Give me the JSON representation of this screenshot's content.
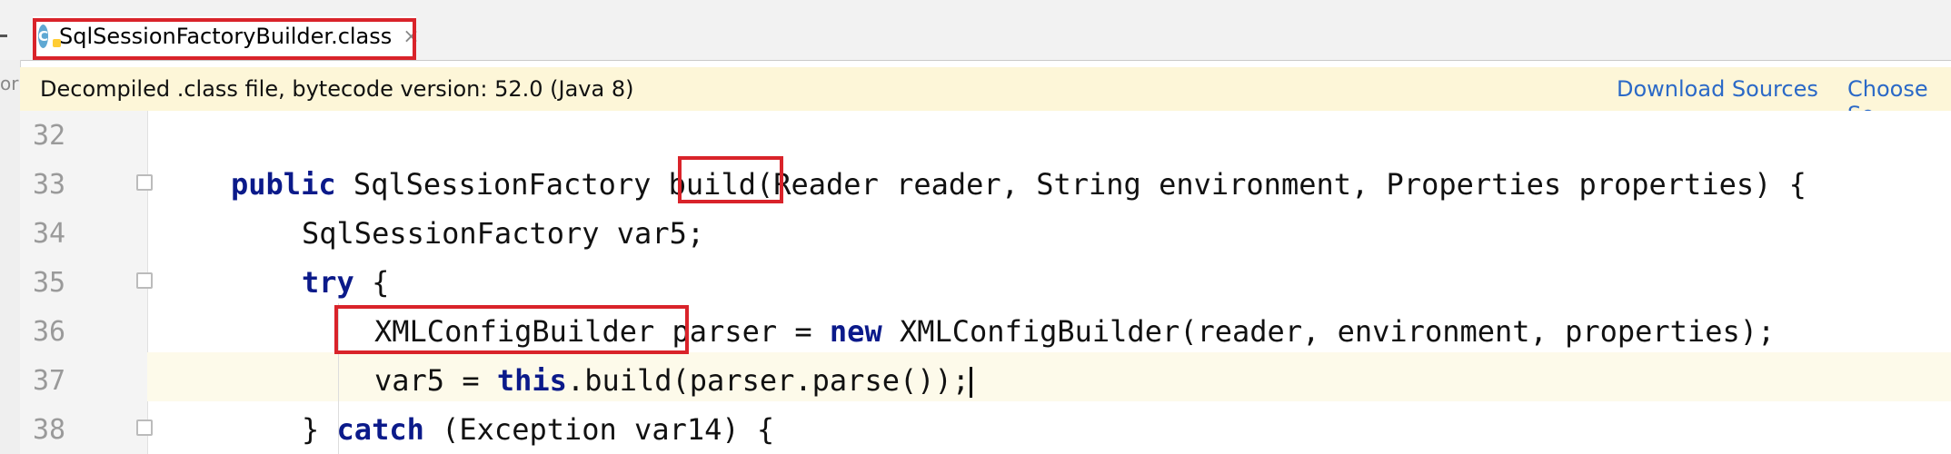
{
  "tab": {
    "icon_letter": "C",
    "title": "SqlSessionFactoryBuilder.class",
    "close_glyph": "×"
  },
  "banner": {
    "gutter_label": "or",
    "message": "Decompiled .class file, bytecode version: 52.0 (Java 8)",
    "download_sources": "Download Sources",
    "choose_sources": "Choose So"
  },
  "code": {
    "lines": [
      {
        "number": "32",
        "parts": []
      },
      {
        "number": "33",
        "parts": [
          {
            "text": "public",
            "kw": true
          },
          {
            "text": " SqlSessionFactory ",
            "kw": false
          },
          {
            "text": "build",
            "kw": false
          },
          {
            "text": "(Reader reader, String environment, Properties properties) {",
            "kw": false
          }
        ]
      },
      {
        "number": "34",
        "parts": [
          {
            "text": "SqlSessionFactory var5;",
            "kw": false
          }
        ]
      },
      {
        "number": "35",
        "parts": [
          {
            "text": "try",
            "kw": true
          },
          {
            "text": " {",
            "kw": false
          }
        ]
      },
      {
        "number": "36",
        "parts": [
          {
            "text": "XMLConfigBuilder",
            "kw": false
          },
          {
            "text": " parser = ",
            "kw": false
          },
          {
            "text": "new",
            "kw": true
          },
          {
            "text": " XMLConfigBuilder(reader, environment, properties);",
            "kw": false
          }
        ]
      },
      {
        "number": "37",
        "parts": [
          {
            "text": "var5 = ",
            "kw": false
          },
          {
            "text": "this",
            "kw": true
          },
          {
            "text": ".build(parser.parse());",
            "kw": false
          }
        ]
      },
      {
        "number": "38",
        "parts": [
          {
            "text": "} ",
            "kw": false
          },
          {
            "text": "catch",
            "kw": true
          },
          {
            "text": " (Exception var14) {",
            "kw": false
          }
        ]
      }
    ]
  },
  "colors": {
    "keyword": "#0b1a8a",
    "highlight_box": "#d9232a",
    "link": "#2b69c7",
    "banner_bg": "#fdf6d8"
  }
}
